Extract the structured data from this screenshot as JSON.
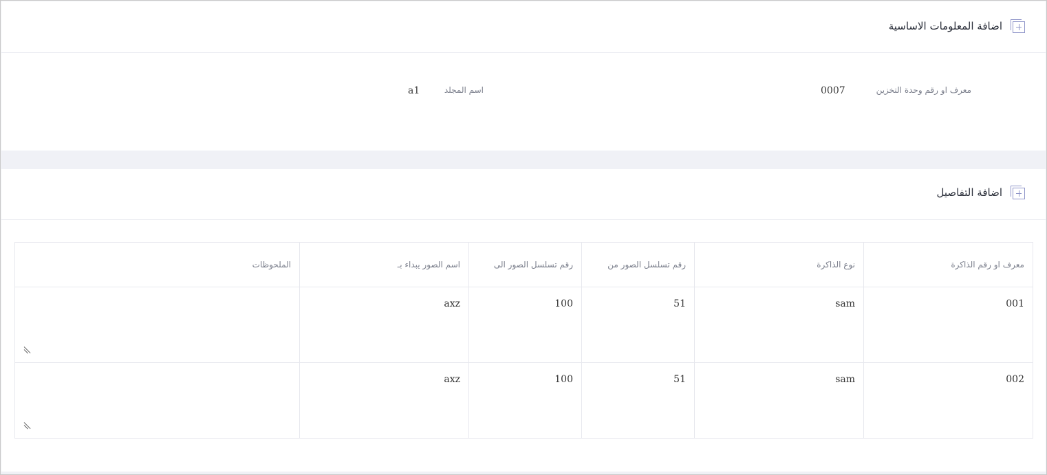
{
  "basic_info": {
    "title": "اضافة المعلومات الاساسية",
    "storage_label": "معرف او رقم وحدة التخزين",
    "storage_value": "0007",
    "folder_label": "اسم المجلد",
    "folder_value": "a1"
  },
  "details": {
    "title": "اضافة التفاصيل",
    "columns": [
      "معرف او رقم الذاكرة",
      "نوع الذاكرة",
      "رقم تسلسل الصور من",
      "رقم تسلسل الصور الى",
      "اسم الصور يبداء بـ",
      "الملحوظات"
    ],
    "rows": [
      {
        "memory_id": "001",
        "memory_type": "sam",
        "seq_from": "51",
        "seq_to": "100",
        "prefix": "axz",
        "notes": ""
      },
      {
        "memory_id": "002",
        "memory_type": "sam",
        "seq_from": "51",
        "seq_to": "100",
        "prefix": "axz",
        "notes": ""
      }
    ]
  },
  "colors": {
    "icon": "#8f95c9",
    "border": "#e7e8ee",
    "page_background": "#f0f1f6"
  }
}
